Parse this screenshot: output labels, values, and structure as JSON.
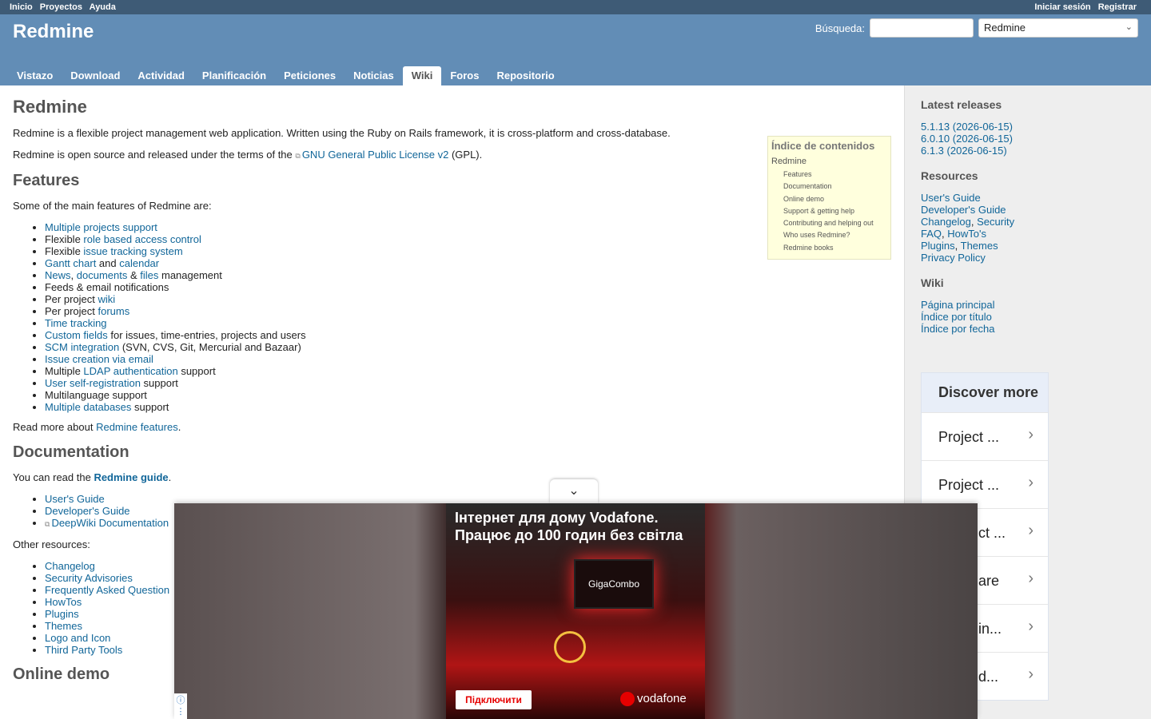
{
  "top_menu": {
    "left": [
      "Inicio",
      "Proyectos",
      "Ayuda"
    ],
    "right": [
      "Iniciar sesión",
      "Registrar"
    ]
  },
  "header": {
    "title": "Redmine",
    "search_label": "Búsqueda:",
    "search_placeholder": "",
    "project_select": "Redmine"
  },
  "main_menu": [
    "Vistazo",
    "Download",
    "Actividad",
    "Planificación",
    "Peticiones",
    "Noticias",
    "Wiki",
    "Foros",
    "Repositorio"
  ],
  "main_menu_selected": "Wiki",
  "content": {
    "title": "Redmine",
    "intro1": "Redmine is a flexible project management web application. Written using the Ruby on Rails framework, it is cross-platform and cross-database.",
    "intro2_pre": "Redmine is open source and released under the terms of the ",
    "intro2_link": "GNU General Public License v2",
    "intro2_post": " (GPL).",
    "features_title": "Features",
    "features_intro": "Some of the main features of Redmine are:",
    "features": [
      [
        {
          "l": "Multiple projects support"
        }
      ],
      [
        {
          "t": "Flexible "
        },
        {
          "l": "role based access control"
        }
      ],
      [
        {
          "t": "Flexible "
        },
        {
          "l": "issue tracking system"
        }
      ],
      [
        {
          "l": "Gantt chart"
        },
        {
          "t": " and "
        },
        {
          "l": "calendar"
        }
      ],
      [
        {
          "l": "News"
        },
        {
          "t": ", "
        },
        {
          "l": "documents"
        },
        {
          "t": " & "
        },
        {
          "l": "files"
        },
        {
          "t": " management"
        }
      ],
      [
        {
          "t": "Feeds & email notifications"
        }
      ],
      [
        {
          "t": "Per project "
        },
        {
          "l": "wiki"
        }
      ],
      [
        {
          "t": "Per project "
        },
        {
          "l": "forums"
        }
      ],
      [
        {
          "l": "Time tracking"
        }
      ],
      [
        {
          "l": "Custom fields"
        },
        {
          "t": " for issues, time-entries, projects and users"
        }
      ],
      [
        {
          "l": "SCM integration"
        },
        {
          "t": " (SVN, CVS, Git, Mercurial and Bazaar)"
        }
      ],
      [
        {
          "l": "Issue creation via email"
        }
      ],
      [
        {
          "t": "Multiple "
        },
        {
          "l": "LDAP authentication"
        },
        {
          "t": " support"
        }
      ],
      [
        {
          "l": "User self-registration"
        },
        {
          "t": " support"
        }
      ],
      [
        {
          "t": "Multilanguage support"
        }
      ],
      [
        {
          "l": "Multiple databases"
        },
        {
          "t": " support"
        }
      ]
    ],
    "read_more_pre": "Read more about ",
    "read_more_link": "Redmine features",
    "read_more_post": ".",
    "doc_title": "Documentation",
    "doc_pre": "You can read the ",
    "doc_link": "Redmine guide",
    "doc_post": ".",
    "doc_links": [
      "User's Guide",
      "Developer's Guide",
      "DeepWiki Documentation"
    ],
    "other_resources": "Other resources:",
    "other_links": [
      "Changelog",
      "Security Advisories",
      "Frequently Asked Question",
      "HowTos",
      "Plugins",
      "Themes",
      "Logo and Icon",
      "Third Party Tools"
    ],
    "demo_title": "Online demo"
  },
  "toc": {
    "head": "Índice de contenidos",
    "root": "Redmine",
    "items": [
      "Features",
      "Documentation",
      "Online demo",
      "Support & getting help",
      "Contributing and helping out",
      "Who uses Redmine?",
      "Redmine books"
    ]
  },
  "sidebar": {
    "releases_title": "Latest releases",
    "releases": [
      "5.1.13 (2026-06-15)",
      "6.0.10 (2026-06-15)",
      "6.1.3 (2026-06-15)"
    ],
    "resources_title": "Resources",
    "resources": [
      [
        "User's Guide"
      ],
      [
        "Developer's Guide"
      ],
      [
        "Changelog",
        "Security"
      ],
      [
        "FAQ",
        "HowTo's"
      ],
      [
        "Plugins",
        "Themes"
      ],
      [
        "Privacy Policy"
      ]
    ],
    "wiki_title": "Wiki",
    "wiki": [
      "Página principal",
      "Índice por título",
      "Índice por fecha"
    ],
    "discover_title": "Discover more",
    "discover_items": [
      "Project ...",
      "Project ...",
      "ct ...",
      "are",
      "in...",
      "d...",
      ""
    ]
  },
  "ad": {
    "line1": "Інтернет для дому Vodafone.",
    "line2": "Працює до 100 годин без світла",
    "tv_label": "GigaCombo",
    "cta": "Підключити",
    "brand": "vodafone"
  }
}
